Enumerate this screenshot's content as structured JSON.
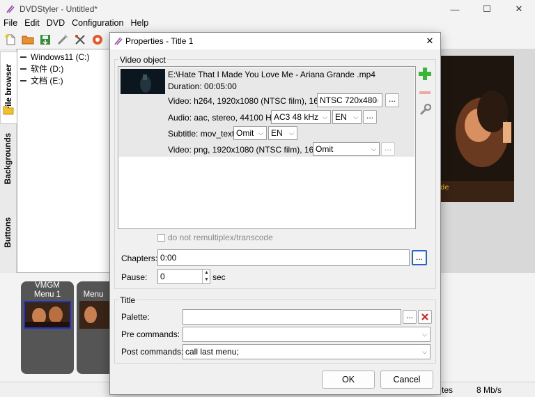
{
  "app": {
    "title": "DVDStyler - Untitled*",
    "window_controls": {
      "minimize": "—",
      "maximize": "☐",
      "close": "✕"
    }
  },
  "menubar": [
    "File",
    "Edit",
    "DVD",
    "Configuration",
    "Help"
  ],
  "toolbar_icons": [
    "new-icon",
    "open-icon",
    "save-icon",
    "burn-icon",
    "settings-icon",
    "record-icon"
  ],
  "sidebar": {
    "tabs": [
      "File browser",
      "Backgrounds",
      "Buttons"
    ],
    "drives": [
      "Windows11 (C:)",
      "软件 (D:)",
      "文档 (E:)"
    ]
  },
  "menus_panel": {
    "vmgm_label": "VMGM",
    "cards": [
      "Menu 1",
      "Menu"
    ]
  },
  "status": {
    "left_text": "tes",
    "rate": "8 Mb/s"
  },
  "dialog": {
    "title": "Properties - Title 1",
    "close": "✕",
    "video_object": {
      "group_label": "Video object",
      "file": "E:\\Hate That I Made You Love Me - Ariana Grande .mp4",
      "duration": "Duration: 00:05:00",
      "video_line": "Video: h264, 1920x1080 (NTSC film), 16:9",
      "video_format": "NTSC 720x480",
      "audio_line": "Audio: aac, stereo, 44100 Hz",
      "audio_format": "AC3 48 kHz",
      "audio_lang": "EN",
      "subtitle_line": "Subtitle: mov_text",
      "subtitle_mode": "Omit",
      "subtitle_lang": "EN",
      "video2_line": "Video: png, 1920x1080 (NTSC film), 16:9",
      "video2_mode": "Omit",
      "ellipsis": "..."
    },
    "remux_label": "do not remultiplex/transcode",
    "chapters_label": "Chapters:",
    "chapters_value": "0:00",
    "pause_label": "Pause:",
    "pause_value": "0",
    "pause_unit": "sec",
    "title_group": {
      "label": "Title",
      "palette_label": "Palette:",
      "palette_value": "",
      "pre_label": "Pre commands:",
      "pre_value": "",
      "post_label": "Post commands:",
      "post_value": "call last menu;"
    },
    "ok_label": "OK",
    "cancel_label": "Cancel"
  },
  "colors": {
    "add": "#3ab53a",
    "remove": "#e0504a",
    "clear": "#d02020",
    "selected_border": "#1e33c8"
  }
}
